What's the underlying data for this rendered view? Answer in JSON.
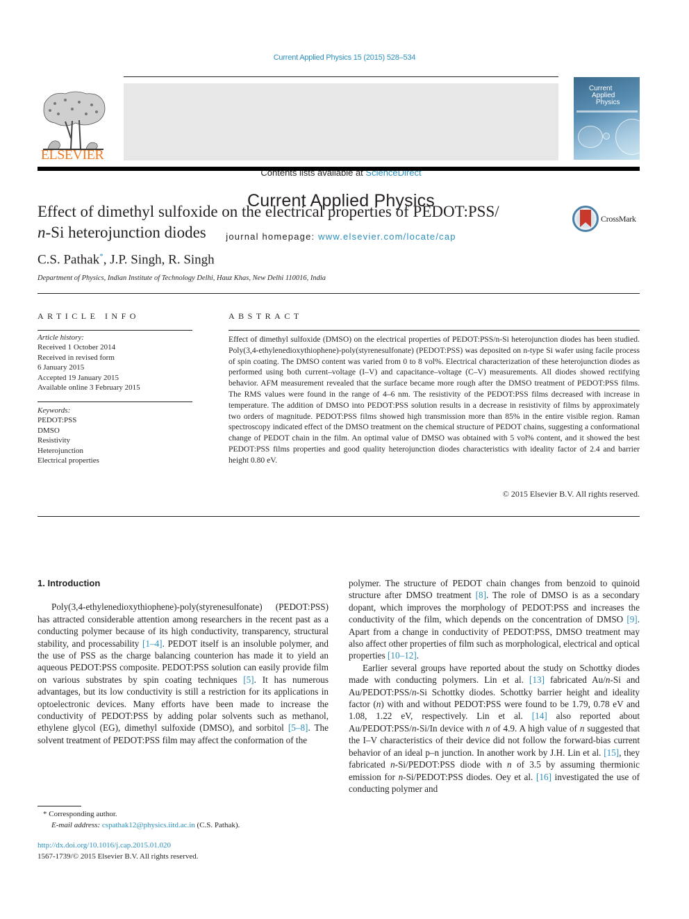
{
  "header": {
    "citation": "Current Applied Physics 15 (2015) 528–534",
    "publisher_wordmark": "ELSEVIER",
    "contents_prefix": "Contents lists available at ",
    "contents_link": "ScienceDirect",
    "journal_title": "Current Applied Physics",
    "homepage_prefix": "journal homepage: ",
    "homepage_link": "www.elsevier.com/locate/cap",
    "cover_title_lines": [
      "Current",
      "Applied",
      "Physics"
    ],
    "colors": {
      "link": "#2a8fbd",
      "elsevier_orange": "#f47a20",
      "banner_gray": "#e7e7e7"
    }
  },
  "article": {
    "title_line1": "Effect of dimethyl sulfoxide on the electrical properties of PEDOT:PSS/",
    "title_line2_italic": "n",
    "title_line2_rest": "-Si heterojunction diodes",
    "crossmark_label": "CrossMark",
    "authors": [
      {
        "name": "C.S. Pathak",
        "mark": "*"
      },
      {
        "name": "J.P. Singh",
        "mark": ""
      },
      {
        "name": "R. Singh",
        "mark": ""
      }
    ],
    "affiliation": "Department of Physics, Indian Institute of Technology Delhi, Hauz Khas, New Delhi 110016, India"
  },
  "article_info": {
    "heading": "ARTICLE INFO",
    "history_label": "Article history:",
    "history": [
      "Received 1 October 2014",
      "Received in revised form",
      "6 January 2015",
      "Accepted 19 January 2015",
      "Available online 3 February 2015"
    ],
    "keywords_label": "Keywords:",
    "keywords": [
      "PEDOT:PSS",
      "DMSO",
      "Resistivity",
      "Heterojunction",
      "Electrical properties"
    ]
  },
  "abstract": {
    "heading": "ABSTRACT",
    "text": "Effect of dimethyl sulfoxide (DMSO) on the electrical properties of PEDOT:PSS/n-Si heterojunction diodes has been studied. Poly(3,4-ethylenedioxythiophene)-poly(styrenesulfonate) (PEDOT:PSS) was deposited on n-type Si wafer using facile process of spin coating. The DMSO content was varied from 0 to 8 vol%. Electrical characterization of these heterojunction diodes as performed using both current–voltage (I–V) and capacitance–voltage (C–V) measurements. All diodes showed rectifying behavior. AFM measurement revealed that the surface became more rough after the DMSO treatment of PEDOT:PSS films. The RMS values were found in the range of 4–6 nm. The resistivity of the PEDOT:PSS films decreased with increase in temperature. The addition of DMSO into PEDOT:PSS solution results in a decrease in resistivity of films by approximately two orders of magnitude. PEDOT:PSS films showed high transmission more than 85% in the entire visible region. Raman spectroscopy indicated effect of the DMSO treatment on the chemical structure of PEDOT chains, suggesting a conformational change of PEDOT chain in the film. An optimal value of DMSO was obtained with 5 vol% content, and it showed the best PEDOT:PSS films properties and good quality heterojunction diodes characteristics with ideality factor of 2.4 and barrier height 0.80 eV.",
    "copyright": "© 2015 Elsevier B.V. All rights reserved."
  },
  "body": {
    "section_title": "1.  Introduction",
    "left_column": [
      {
        "type": "text",
        "value": "Poly(3,4-ethylenedioxythiophene)-poly(styrenesulfonate) (PEDOT:PSS) has attracted considerable attention among researchers in the recent past as a conducting polymer because of its high conductivity, transparency, structural stability, and processability "
      },
      {
        "type": "ref",
        "value": "[1–4]"
      },
      {
        "type": "text",
        "value": ". PEDOT itself is an insoluble polymer, and the use of PSS as the charge balancing counterion has made it to yield an aqueous PEDOT:PSS composite. PEDOT:PSS solution can easily provide film on various substrates by spin coating techniques "
      },
      {
        "type": "ref",
        "value": "[5]"
      },
      {
        "type": "text",
        "value": ". It has numerous advantages, but its low conductivity is still a restriction for its applications in optoelectronic devices. Many efforts have been made to increase the conductivity of PEDOT:PSS by adding polar solvents such as methanol, ethylene glycol (EG), dimethyl sulfoxide (DMSO), and sorbitol "
      },
      {
        "type": "ref",
        "value": "[5–8]"
      },
      {
        "type": "text",
        "value": ". The solvent treatment of PEDOT:PSS film may affect the conformation of the"
      }
    ],
    "right_para1": [
      {
        "type": "text",
        "value": "polymer. The structure of PEDOT chain changes from benzoid to quinoid structure after DMSO treatment "
      },
      {
        "type": "ref",
        "value": "[8]"
      },
      {
        "type": "text",
        "value": ". The role of DMSO is as a secondary dopant, which improves the morphology of PEDOT:PSS and increases the conductivity of the film, which depends on the concentration of DMSO "
      },
      {
        "type": "ref",
        "value": "[9]"
      },
      {
        "type": "text",
        "value": ". Apart from a change in conductivity of PEDOT:PSS, DMSO treatment may also affect other properties of film such as morphological, electrical and optical properties "
      },
      {
        "type": "ref",
        "value": "[10–12]"
      },
      {
        "type": "text",
        "value": "."
      }
    ],
    "right_para2": [
      {
        "type": "text",
        "value": "Earlier several groups have reported about the study on Schottky diodes made with conducting polymers. Lin et al. "
      },
      {
        "type": "ref",
        "value": "[13]"
      },
      {
        "type": "text",
        "value": " fabricated Au/"
      },
      {
        "type": "italic",
        "value": "n"
      },
      {
        "type": "text",
        "value": "-Si and Au/PEDOT:PSS/"
      },
      {
        "type": "italic",
        "value": "n"
      },
      {
        "type": "text",
        "value": "-Si Schottky diodes. Schottky barrier height and ideality factor ("
      },
      {
        "type": "italic",
        "value": "n"
      },
      {
        "type": "text",
        "value": ") with and without PEDOT:PSS were found to be 1.79, 0.78 eV and 1.08, 1.22 eV, respectively. Lin et al. "
      },
      {
        "type": "ref",
        "value": "[14]"
      },
      {
        "type": "text",
        "value": " also reported about Au/PEDOT:PSS/"
      },
      {
        "type": "italic",
        "value": "n"
      },
      {
        "type": "text",
        "value": "-Si/In device with "
      },
      {
        "type": "italic",
        "value": "n"
      },
      {
        "type": "text",
        "value": " of 4.9. A high value of "
      },
      {
        "type": "italic",
        "value": "n"
      },
      {
        "type": "text",
        "value": " suggested that the I–V characteristics of their device did not follow the forward-bias current behavior of an ideal p–n junction. In another work by J.H. Lin et al. "
      },
      {
        "type": "ref",
        "value": "[15]"
      },
      {
        "type": "text",
        "value": ", they fabricated "
      },
      {
        "type": "italic",
        "value": "n"
      },
      {
        "type": "text",
        "value": "-Si/PEDOT:PSS diode with "
      },
      {
        "type": "italic",
        "value": "n"
      },
      {
        "type": "text",
        "value": " of 3.5 by assuming thermionic emission for "
      },
      {
        "type": "italic",
        "value": "n"
      },
      {
        "type": "text",
        "value": "-Si/PEDOT:PSS diodes. Oey et al. "
      },
      {
        "type": "ref",
        "value": "[16]"
      },
      {
        "type": "text",
        "value": " investigated the use of conducting polymer and"
      }
    ]
  },
  "footnotes": {
    "corresponding_mark": "*",
    "corresponding_text": "Corresponding author.",
    "email_label": "E-mail address:",
    "email": "cspathak12@physics.iitd.ac.in",
    "email_owner": "(C.S. Pathak).",
    "doi": "http://dx.doi.org/10.1016/j.cap.2015.01.020",
    "issn_copyright": "1567-1739/© 2015 Elsevier B.V. All rights reserved."
  }
}
